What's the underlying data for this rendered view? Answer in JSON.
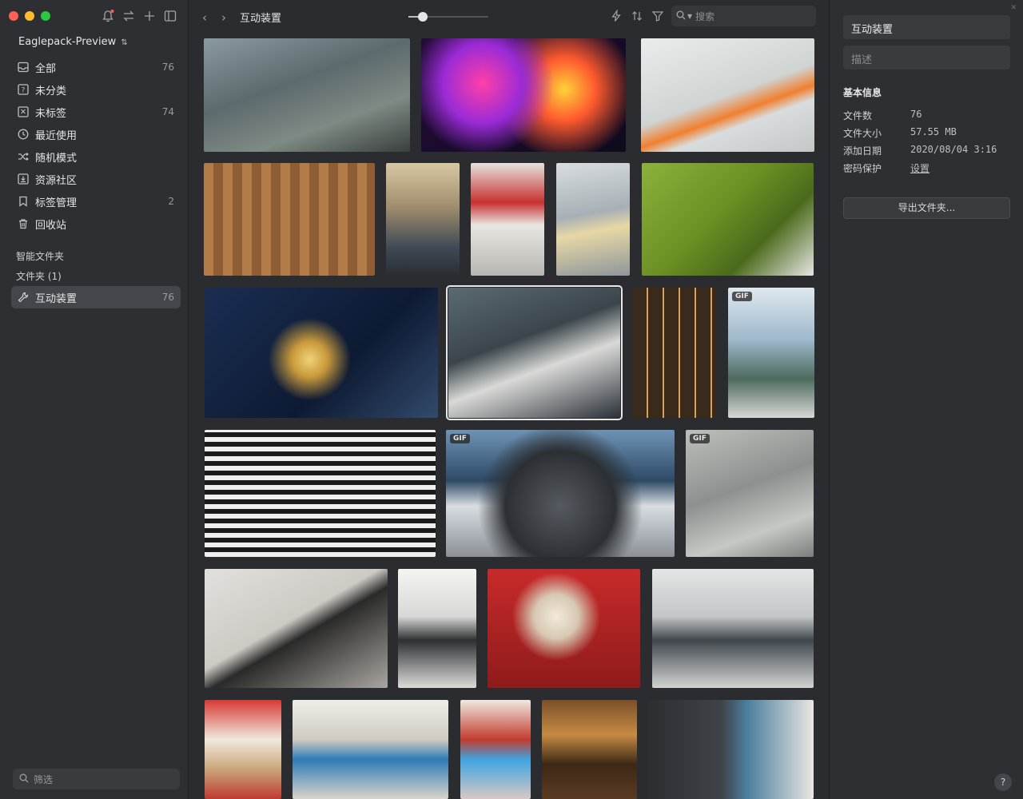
{
  "library": {
    "name": "Eaglepack-Preview",
    "arrow": "⌃"
  },
  "nav": [
    {
      "label": "全部",
      "count": "76",
      "icon": "inbox-icon"
    },
    {
      "label": "未分类",
      "count": "",
      "icon": "unknown-icon"
    },
    {
      "label": "未标签",
      "count": "74",
      "icon": "untagged-icon"
    },
    {
      "label": "最近使用",
      "count": "",
      "icon": "clock-icon"
    },
    {
      "label": "随机模式",
      "count": "",
      "icon": "shuffle-icon"
    },
    {
      "label": "资源社区",
      "count": "",
      "icon": "download-icon"
    },
    {
      "label": "标签管理",
      "count": "2",
      "icon": "bookmark-icon"
    },
    {
      "label": "回收站",
      "count": "",
      "icon": "trash-icon"
    }
  ],
  "sections": {
    "smart_folders": "智能文件夹",
    "folders": "文件夹 (1)"
  },
  "folder_item": {
    "label": "互动装置",
    "count": "76"
  },
  "filter_placeholder": "筛选",
  "toolbar": {
    "breadcrumb": "互动装置",
    "search_placeholder": "搜索",
    "zoom": 0.18
  },
  "grid": {
    "badges": {
      "gif": "GIF"
    },
    "selected_index": 9
  },
  "inspector": {
    "title": "互动装置",
    "description_placeholder": "描述",
    "section_title": "基本信息",
    "rows": [
      {
        "label": "文件数",
        "value": "76"
      },
      {
        "label": "文件大小",
        "value": "57.55 MB"
      },
      {
        "label": "添加日期",
        "value": "2020/08/04 3:16"
      },
      {
        "label": "密码保护",
        "value": "设置"
      }
    ],
    "export_button": "导出文件夹...",
    "help": "?"
  },
  "colors": {
    "accent": "#45464b",
    "sidebar_bg": "#2e2f33",
    "main_bg": "#2b2c2f"
  }
}
